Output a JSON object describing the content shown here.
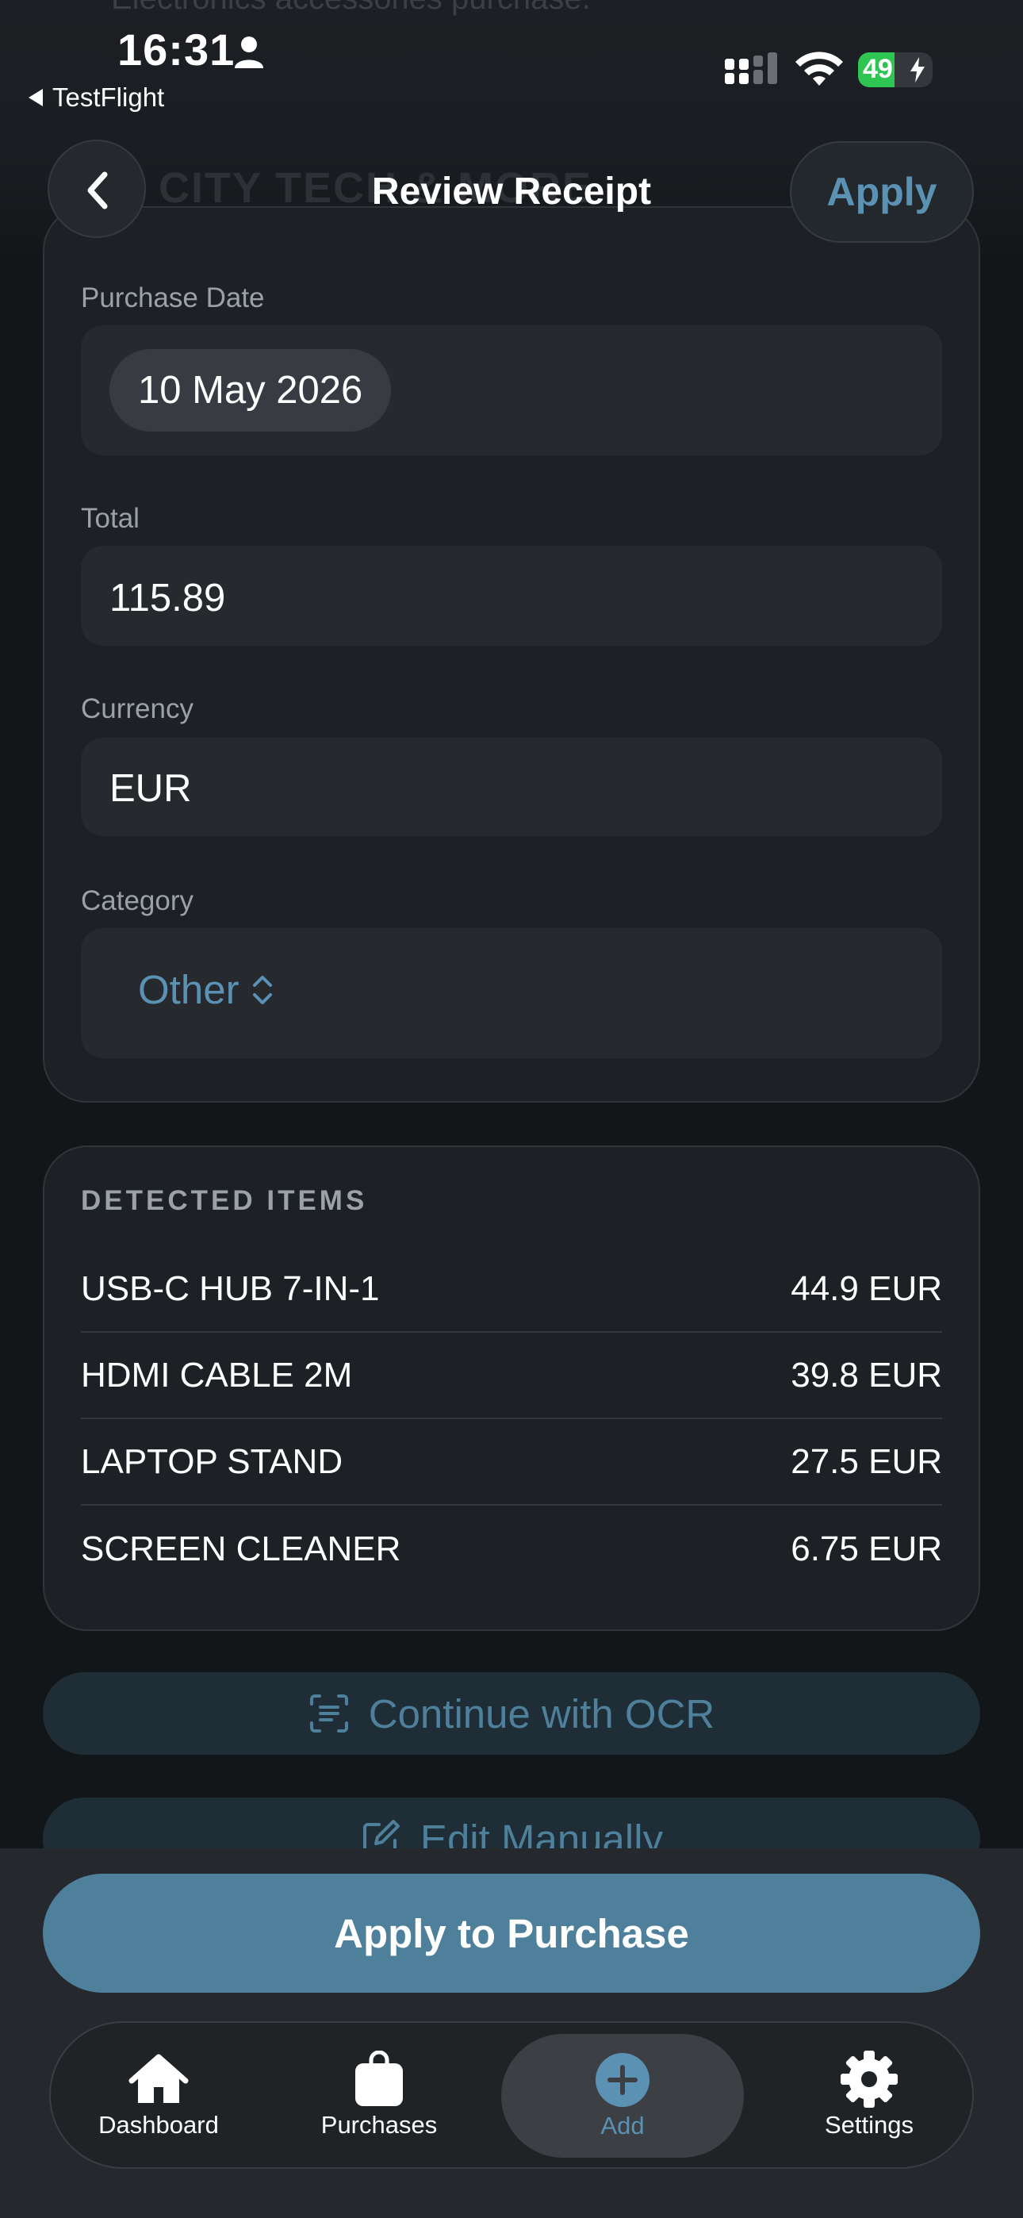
{
  "status_bar": {
    "time": "16:31",
    "back_app": "TestFlight",
    "battery_percent": "49",
    "battery_level": 0.49
  },
  "background_ghost": {
    "line1": "Electronics accessories purchase.",
    "line2": "CITY TECH & MORE"
  },
  "nav": {
    "title": "Review Receipt",
    "apply_label": "Apply"
  },
  "form": {
    "purchase_date_label": "Purchase Date",
    "purchase_date_value": "10 May 2026",
    "total_label": "Total",
    "total_value": "115.89",
    "currency_label": "Currency",
    "currency_value": "EUR",
    "category_label": "Category",
    "category_value": "Other"
  },
  "detected_items": {
    "title": "DETECTED ITEMS",
    "items": [
      {
        "name": "USB-C HUB 7-IN-1",
        "price": "44.9 EUR"
      },
      {
        "name": "HDMI CABLE 2M",
        "price": "39.8 EUR"
      },
      {
        "name": "LAPTOP STAND",
        "price": "27.5 EUR"
      },
      {
        "name": "SCREEN CLEANER",
        "price": "6.75 EUR"
      }
    ]
  },
  "actions": {
    "ocr_label": "Continue with OCR",
    "edit_label": "Edit Manually",
    "primary_label": "Apply to Purchase"
  },
  "tabbar": {
    "tabs": [
      {
        "label": "Dashboard",
        "icon": "house-icon"
      },
      {
        "label": "Purchases",
        "icon": "bag-icon"
      },
      {
        "label": "Add",
        "icon": "plus-circle-icon",
        "active": true
      },
      {
        "label": "Settings",
        "icon": "gear-icon"
      }
    ]
  },
  "colors": {
    "accent": "#4e7f9b",
    "accent_text": "#5b92b3",
    "background": "#131619",
    "card": "#1d2024",
    "battery_green": "#2fc553"
  }
}
